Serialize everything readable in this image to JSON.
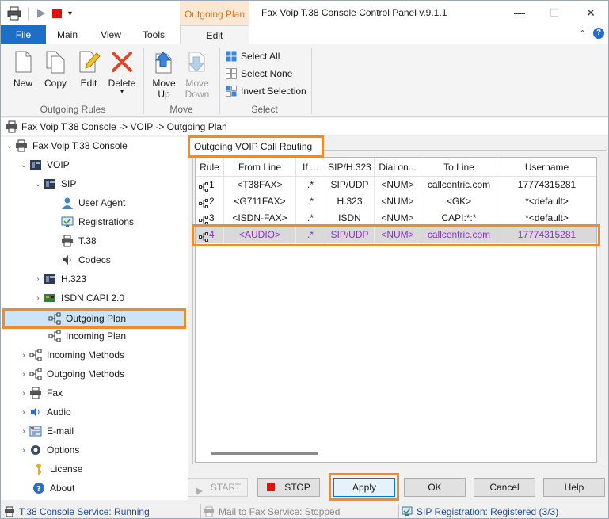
{
  "window": {
    "title": "Fax Voip T.38 Console Control Panel v.9.1.1",
    "context_tab": "Outgoing Plan"
  },
  "ribbon": {
    "tabs": [
      "File",
      "Main",
      "View",
      "Tools",
      "Edit"
    ],
    "buttons": {
      "new": "New",
      "copy": "Copy",
      "edit": "Edit",
      "delete": "Delete",
      "move_up": "Move Up",
      "move_down": "Move Down"
    },
    "select": {
      "select_all": "Select All",
      "select_none": "Select None",
      "invert": "Invert Selection"
    },
    "groups": {
      "outgoing_rules": "Outgoing Rules",
      "move": "Move",
      "select": "Select"
    }
  },
  "breadcrumb": "Fax Voip T.38 Console -> VOIP -> Outgoing Plan",
  "tree": {
    "root": "Fax Voip T.38 Console",
    "voip": "VOIP",
    "sip": "SIP",
    "user_agent": "User Agent",
    "registrations": "Registrations",
    "t38": "T.38",
    "codecs": "Codecs",
    "h323": "H.323",
    "isdn": "ISDN CAPI 2.0",
    "outgoing_plan": "Outgoing Plan",
    "incoming_plan": "Incoming Plan",
    "incoming_methods": "Incoming Methods",
    "outgoing_methods": "Outgoing Methods",
    "fax": "Fax",
    "audio": "Audio",
    "email": "E-mail",
    "options": "Options",
    "license": "License",
    "about": "About"
  },
  "routing": {
    "group_title": "Outgoing VOIP Call Routing",
    "columns": [
      "Rule",
      "From Line",
      "If ...",
      "SIP/H.323",
      "Dial on...",
      "To Line",
      "Username"
    ],
    "rows": [
      [
        "1",
        "<T38FAX>",
        ".*",
        "SIP/UDP",
        "<NUM>",
        "callcentric.com",
        "17774315281"
      ],
      [
        "2",
        "<G711FAX>",
        ".*",
        "H.323",
        "<NUM>",
        "<GK>",
        "*<default>"
      ],
      [
        "3",
        "<ISDN-FAX>",
        ".*",
        "ISDN",
        "<NUM>",
        "CAPI:*:*",
        "*<default>"
      ],
      [
        "4",
        "<AUDIO>",
        ".*",
        "SIP/UDP",
        "<NUM>",
        "callcentric.com",
        "17774315281"
      ]
    ]
  },
  "buttons": {
    "start": "START",
    "stop": "STOP",
    "apply": "Apply",
    "ok": "OK",
    "cancel": "Cancel",
    "help": "Help"
  },
  "status": {
    "t38_service": "T.38 Console Service: Running",
    "mail_service": "Mail to Fax Service: Stopped",
    "sip_registration": "SIP Registration: Registered (3/3)"
  },
  "colors": {
    "accent": "#1e6ec8",
    "highlight": "#f08a2a",
    "selected_row_text": "#8f2fd1"
  }
}
